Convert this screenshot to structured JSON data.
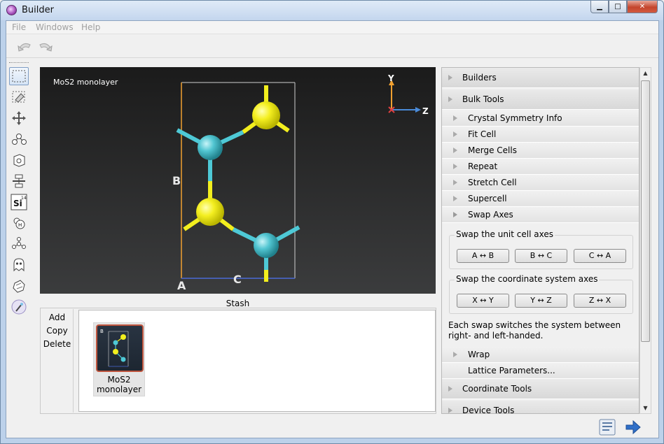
{
  "window": {
    "title": "Builder",
    "controls": {
      "minimize": "▁",
      "maximize": "□",
      "close": "✕"
    }
  },
  "menubar": {
    "items": [
      "File",
      "Windows",
      "Help"
    ]
  },
  "toolbar": {
    "undo_icon": "undo-icon",
    "redo_icon": "redo-icon"
  },
  "left_tools": [
    "select-box-icon",
    "eraser-icon",
    "move-icon",
    "bond-icon",
    "cell-icon",
    "layer-icon",
    "element-icon",
    "hydrogen-icon",
    "network-icon",
    "ghost-icon",
    "rotate-icon",
    "wand-icon"
  ],
  "element_tool": {
    "symbol": "Si",
    "number": "14"
  },
  "hydrogen_tool": {
    "symbol": "H"
  },
  "viewport": {
    "title": "MoS2 monolayer",
    "axis_labels": {
      "y": "Y",
      "z": "Z"
    },
    "cell_labels": {
      "a": "A",
      "b": "B",
      "c": "C"
    }
  },
  "stash": {
    "label": "Stash",
    "buttons": [
      "Add",
      "Copy",
      "Delete"
    ],
    "items": [
      {
        "name": "MoS2 monolayer",
        "thumb_label": "B"
      }
    ]
  },
  "right_panel": {
    "sections": [
      "Builders",
      "Bulk Tools"
    ],
    "bulk_items": [
      "Crystal Symmetry Info",
      "Fit Cell",
      "Merge Cells",
      "Repeat",
      "Stretch Cell",
      "Supercell",
      "Swap Axes"
    ],
    "swap_unit": {
      "title": "Swap the unit cell axes",
      "buttons": [
        "A ↔ B",
        "B ↔ C",
        "C ↔ A"
      ]
    },
    "swap_coord": {
      "title": "Swap the coordinate system axes",
      "buttons": [
        "X ↔ Y",
        "Y ↔ Z",
        "Z ↔ X"
      ]
    },
    "note": "Each swap switches the system between right- and left-handed.",
    "wrap": "Wrap",
    "lattice": "Lattice Parameters...",
    "coordinate_tools": "Coordinate Tools",
    "device_tools": "Device Tools"
  },
  "colors": {
    "sulfur": "#f2ee1e",
    "molybdenum": "#4ec9d6",
    "cell_a": "#f0a030",
    "cell_c": "#4a6ad8"
  }
}
